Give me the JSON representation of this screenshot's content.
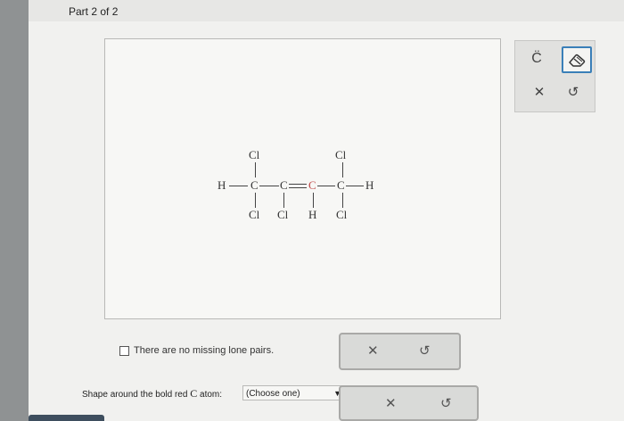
{
  "header": {
    "part_label": "Part 2 of 2"
  },
  "molecule": {
    "atoms": {
      "h_left": "H",
      "c1": "C",
      "c2": "C",
      "c3": "C",
      "c4": "C",
      "h_right": "H",
      "cl_top1": "Cl",
      "cl_top4": "Cl",
      "cl_bot1": "Cl",
      "cl_bot2": "Cl",
      "h_bot3": "H",
      "cl_bot4": "Cl"
    }
  },
  "toolbox": {
    "lonepair_symbol": "C̈",
    "clear_symbol": "✕",
    "undo_symbol": "↺"
  },
  "checkbox": {
    "label": "There are no missing lone pairs."
  },
  "actions": {
    "clear_symbol": "✕",
    "undo_symbol": "↺"
  },
  "question": {
    "prefix": "Shape around the bold red ",
    "atom": "C",
    "suffix": " atom:",
    "select_value": "(Choose one)",
    "arrow": "▼"
  }
}
